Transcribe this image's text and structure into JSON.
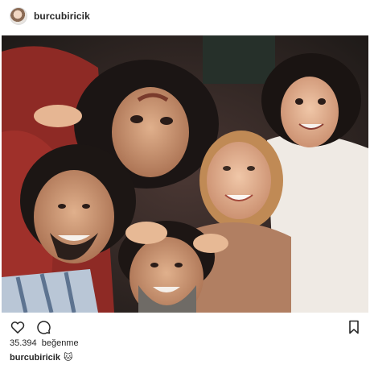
{
  "post": {
    "username": "burcubiricik",
    "likes_count": "35.394",
    "likes_label": "beğenme",
    "caption_user": "burcubiricik",
    "caption_emoji": "🐱"
  },
  "icons": {
    "like": "heart-outline-icon",
    "comment": "comment-bubble-icon",
    "save": "bookmark-icon"
  },
  "colors": {
    "text": "#262626",
    "border": "#dbdbdb",
    "background": "#ffffff"
  }
}
